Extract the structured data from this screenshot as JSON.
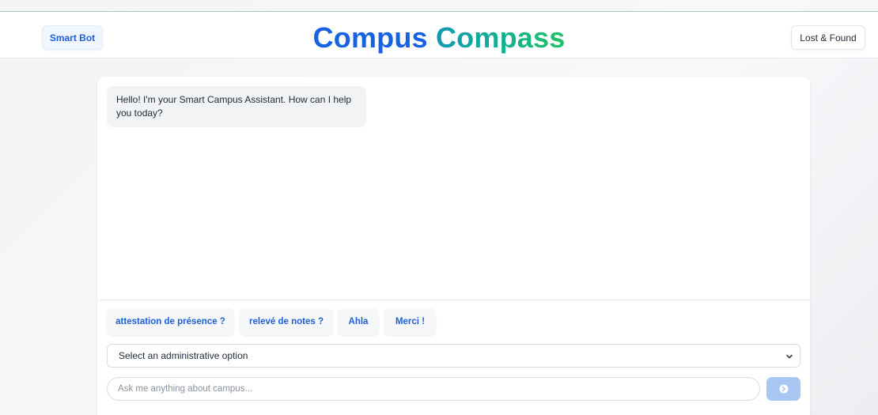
{
  "header": {
    "title_part1": "Compus",
    "title_part2": "Compass",
    "left_button": "Smart Bot",
    "right_button": "Lost & Found"
  },
  "chat": {
    "messages": [
      {
        "sender": "bot",
        "text": "Hello! I'm your Smart Campus Assistant. How can I help you today?"
      }
    ]
  },
  "quick_replies": [
    "attestation de présence ?",
    "relevé de notes ?",
    "Ahla",
    "Merci !"
  ],
  "select": {
    "selected": "Select an administrative option"
  },
  "input": {
    "placeholder": "Ask me anything about campus..."
  },
  "icons": {
    "send": "arrow-right-circle-icon",
    "dropdown": "chevron-down-icon"
  },
  "colors": {
    "brand_blue": "#1762e3",
    "brand_green": "#16b38a",
    "send_button": "#a9c7f3"
  }
}
